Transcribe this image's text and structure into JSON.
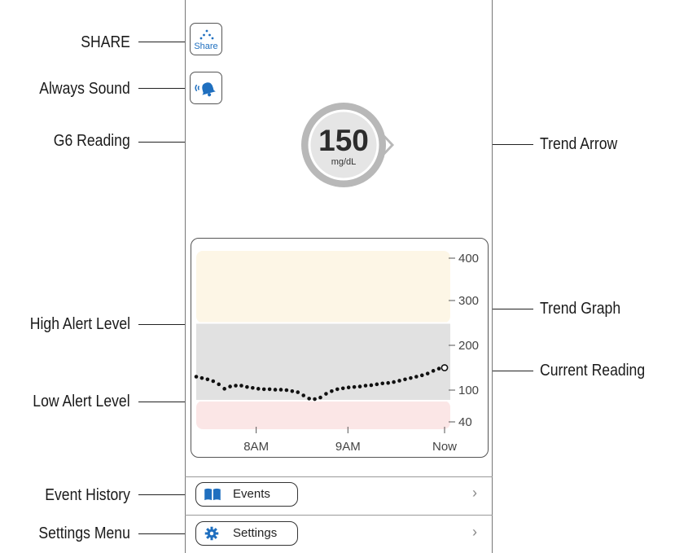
{
  "callouts": {
    "share": "SHARE",
    "always_sound": "Always Sound",
    "g6_reading": "G6 Reading",
    "high_alert": "High Alert Level",
    "low_alert": "Low Alert Level",
    "event_history": "Event History",
    "settings_menu": "Settings Menu",
    "trend_arrow": "Trend Arrow",
    "trend_graph": "Trend Graph",
    "current_reading": "Current Reading"
  },
  "share_button": {
    "label": "Share",
    "icon": "share-dots-icon"
  },
  "sound_button": {
    "icon": "bell-sound-icon"
  },
  "reading": {
    "value": "150",
    "unit": "mg/dL"
  },
  "menu": {
    "events_label": "Events",
    "events_icon": "book-icon",
    "settings_label": "Settings",
    "settings_icon": "gear-icon",
    "chevron": "›"
  },
  "colors": {
    "accent": "#1f6fbf",
    "high_zone": "#fdf6e6",
    "target_zone": "#e1e1e1",
    "low_zone": "#fbe6e6",
    "circle_ring": "#b8b8b8"
  },
  "chart_data": {
    "type": "scatter",
    "ytick_labels": [
      "400",
      "300",
      "200",
      "100",
      "40"
    ],
    "yticks": [
      400,
      300,
      200,
      100,
      40
    ],
    "xtick_labels": [
      "8AM",
      "9AM",
      "Now"
    ],
    "high_alert_level": 250,
    "low_alert_level": 80,
    "x_hours": [
      0,
      0.08,
      0.16,
      0.24,
      0.32,
      0.4,
      0.48,
      0.56,
      0.64,
      0.72,
      0.8,
      0.88,
      0.96,
      1.04,
      1.12,
      1.2,
      1.28,
      1.36,
      1.44,
      1.52,
      1.6,
      1.68,
      1.76,
      1.84,
      1.92,
      2.0,
      2.08,
      2.16,
      2.24,
      2.32,
      2.4,
      2.48,
      2.56,
      2.64,
      2.72,
      2.8,
      2.88,
      2.96,
      3.04,
      3.12,
      3.2,
      3.28,
      3.36,
      3.44,
      3.52
    ],
    "y_values": [
      130,
      127,
      124,
      120,
      113,
      103,
      108,
      110,
      110,
      107,
      105,
      103,
      102,
      102,
      101,
      101,
      100,
      98,
      96,
      90,
      84,
      83,
      86,
      93,
      98,
      102,
      104,
      106,
      107,
      108,
      110,
      111,
      113,
      115,
      116,
      118,
      121,
      124,
      127,
      130,
      133,
      137,
      143,
      148,
      150
    ],
    "x_hours_ticks": [
      0.85,
      2.15,
      3.52
    ],
    "current_index": 44
  }
}
